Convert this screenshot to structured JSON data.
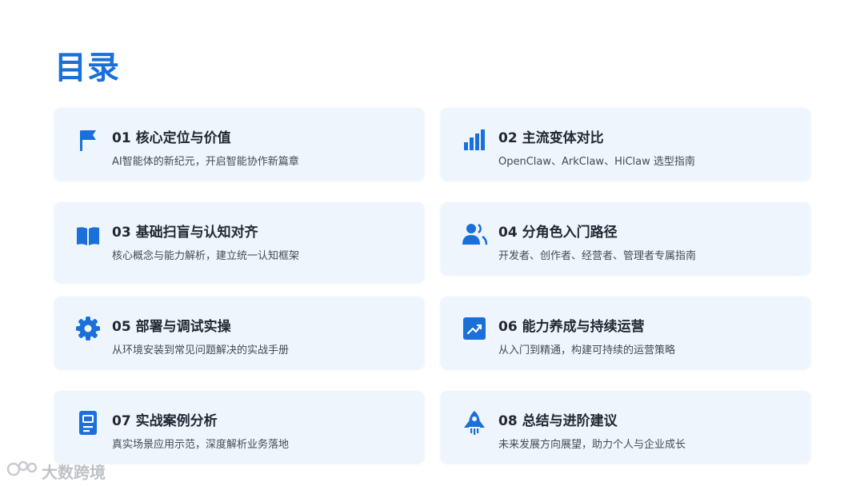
{
  "page": {
    "title": "目录"
  },
  "accent_color": "#1a6fd9",
  "card_bg_color": "#eef5fd",
  "items": [
    {
      "title": "01 核心定位与价值",
      "subtitle": "AI智能体的新纪元，开启智能协作新篇章",
      "icon": "flag-icon"
    },
    {
      "title": "02 主流变体对比",
      "subtitle": "OpenClaw、ArkClaw、HiClaw 选型指南",
      "icon": "bar-chart-icon"
    },
    {
      "title": "03 基础扫盲与认知对齐",
      "subtitle": "核心概念与能力解析，建立统一认知框架",
      "icon": "book-icon"
    },
    {
      "title": "04 分角色入门路径",
      "subtitle": "开发者、创作者、经营者、管理者专属指南",
      "icon": "users-icon"
    },
    {
      "title": "05 部署与调试实操",
      "subtitle": "从环境安装到常见问题解决的实战手册",
      "icon": "gear-icon"
    },
    {
      "title": "06 能力养成与持续运营",
      "subtitle": "从入门到精通，构建可持续的运营策略",
      "icon": "trending-up-icon"
    },
    {
      "title": "07 实战案例分析",
      "subtitle": "真实场景应用示范，深度解析业务落地",
      "icon": "document-icon"
    },
    {
      "title": "08 总结与进阶建议",
      "subtitle": "未来发展方向展望，助力个人与企业成长",
      "icon": "rocket-icon"
    }
  ],
  "watermark": {
    "text": "大数跨境",
    "icon": "logo-icon"
  }
}
